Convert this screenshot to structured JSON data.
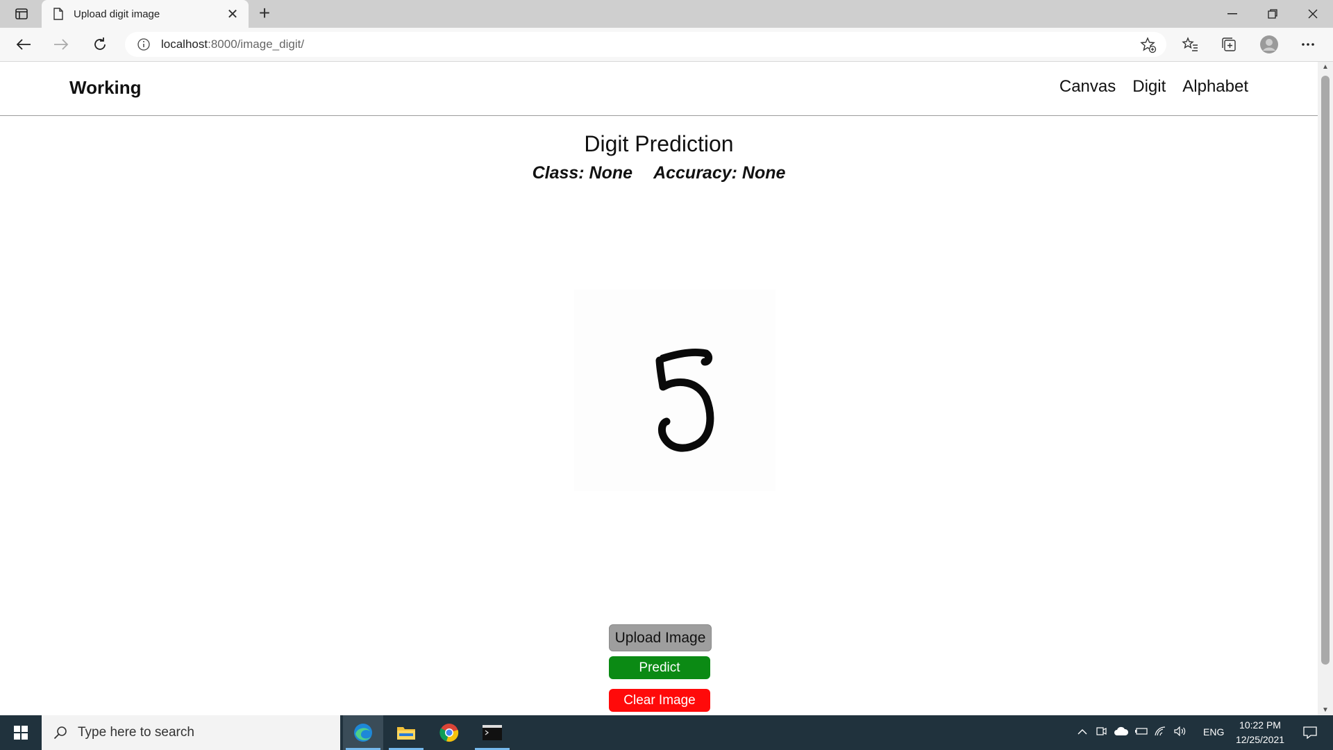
{
  "browser": {
    "tab_title": "Upload digit image",
    "new_tab": "+",
    "url_host": "localhost",
    "url_rest": ":8000/image_digit/"
  },
  "navbar": {
    "brand": "Working",
    "links": [
      "Canvas",
      "Digit",
      "Alphabet"
    ]
  },
  "main": {
    "heading": "Digit Prediction",
    "class_text": "Class: None",
    "accuracy_text": "Accuracy: None",
    "image_digit": "5"
  },
  "buttons": {
    "upload": "Upload Image",
    "predict": "Predict",
    "clear": "Clear Image"
  },
  "colors": {
    "upload_bg": "#9e9e9e",
    "predict_bg": "#0b8a14",
    "clear_bg": "#ff0a0a",
    "taskbar_bg": "#20323d"
  },
  "taskbar": {
    "search_placeholder": "Type here to search",
    "language": "ENG",
    "time": "10:22 PM",
    "date": "12/25/2021",
    "apps": [
      "edge-icon",
      "file-explorer-icon",
      "chrome-icon",
      "terminal-icon"
    ]
  }
}
